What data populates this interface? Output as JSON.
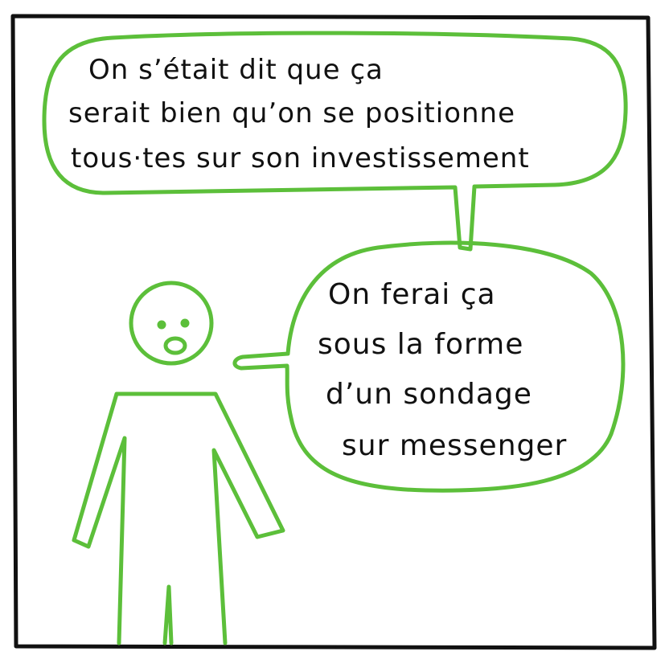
{
  "colors": {
    "panel_border": "#111111",
    "outline": "#5cbf3a",
    "text": "#111111",
    "background": "#ffffff"
  },
  "bubble_top": {
    "lines": [
      "On s’était dit que ça",
      "serait bien qu’on se positionne",
      "tous·tes sur son investissement"
    ]
  },
  "bubble_bottom": {
    "lines": [
      "On ferai ça",
      "sous la forme",
      "d’un sondage",
      "sur messenger"
    ]
  }
}
